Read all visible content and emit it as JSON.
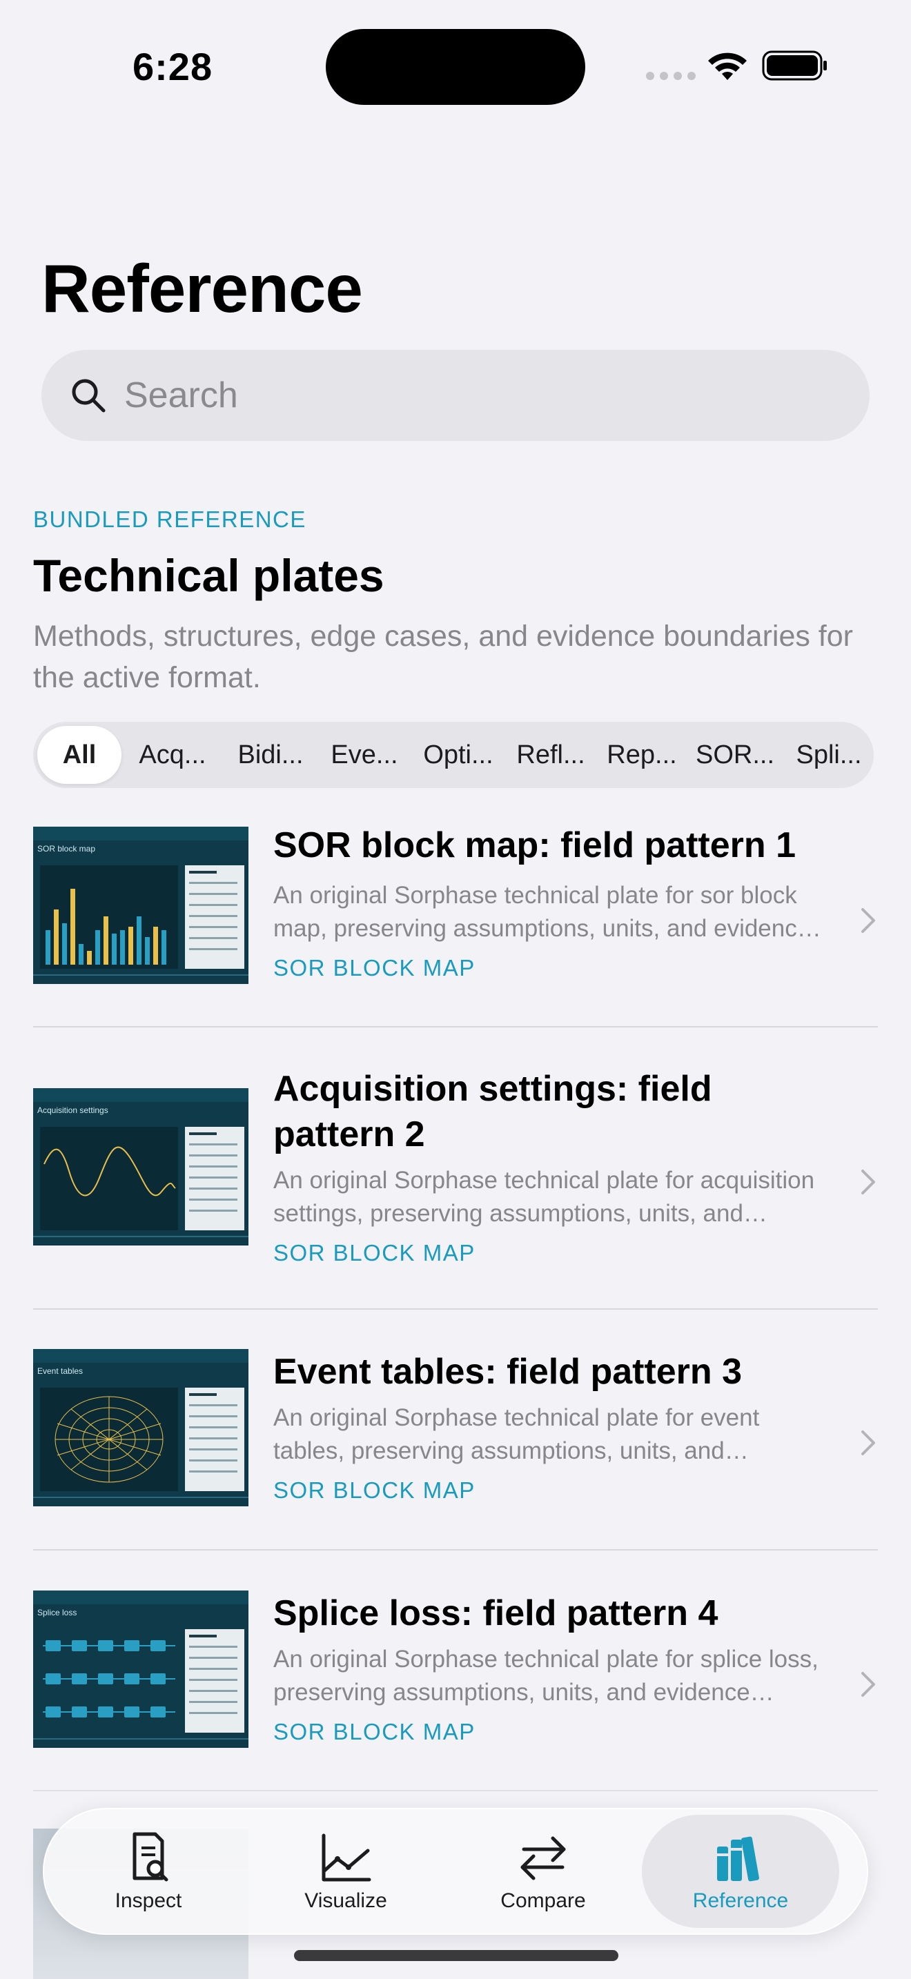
{
  "status": {
    "time": "6:28"
  },
  "page": {
    "title": "Reference"
  },
  "search": {
    "placeholder": "Search"
  },
  "section": {
    "eyebrow": "BUNDLED REFERENCE",
    "title": "Technical plates",
    "description": "Methods, structures, edge cases, and evidence boundaries for the active format."
  },
  "filters": {
    "selected": "All",
    "chips": [
      "All",
      "Acq...",
      "Bidi...",
      "Eve...",
      "Opti...",
      "Refl...",
      "Rep...",
      "SOR...",
      "Spli..."
    ]
  },
  "plates": [
    {
      "title": "SOR block map: field pattern 1",
      "description": "An original Sorphase technical plate for sor block map, preserving assumptions, units, and evidence boundaries.",
      "tag": "SOR BLOCK MAP",
      "thumb_caption": "SOR block map",
      "thumb_icon": "bar-chart-thumbnail"
    },
    {
      "title": "Acquisition settings: field pattern 2",
      "description": "An original Sorphase technical plate for acquisition settings, preserving assumptions, units, and evidence boundaries.",
      "tag": "SOR BLOCK MAP",
      "thumb_caption": "Acquisition settings",
      "thumb_icon": "waveform-thumbnail"
    },
    {
      "title": "Event tables: field pattern 3",
      "description": "An original Sorphase technical plate for event tables, preserving assumptions, units, and evidence boundaries.",
      "tag": "SOR BLOCK MAP",
      "thumb_caption": "Event tables",
      "thumb_icon": "polar-thumbnail"
    },
    {
      "title": "Splice loss: field pattern 4",
      "description": "An original Sorphase technical plate for splice loss, preserving assumptions, units, and evidence boundaries.",
      "tag": "SOR BLOCK MAP",
      "thumb_caption": "Splice loss",
      "thumb_icon": "splice-grid-thumbnail"
    }
  ],
  "tabs": [
    {
      "label": "Inspect",
      "icon": "document-magnifier-icon"
    },
    {
      "label": "Visualize",
      "icon": "line-chart-icon"
    },
    {
      "label": "Compare",
      "icon": "arrows-left-right-icon"
    },
    {
      "label": "Reference",
      "icon": "books-icon"
    }
  ],
  "active_tab": "Reference",
  "colors": {
    "accent": "#1a9bbd",
    "plate_bg": "#0f3a4a",
    "background": "#f2f2f7"
  }
}
